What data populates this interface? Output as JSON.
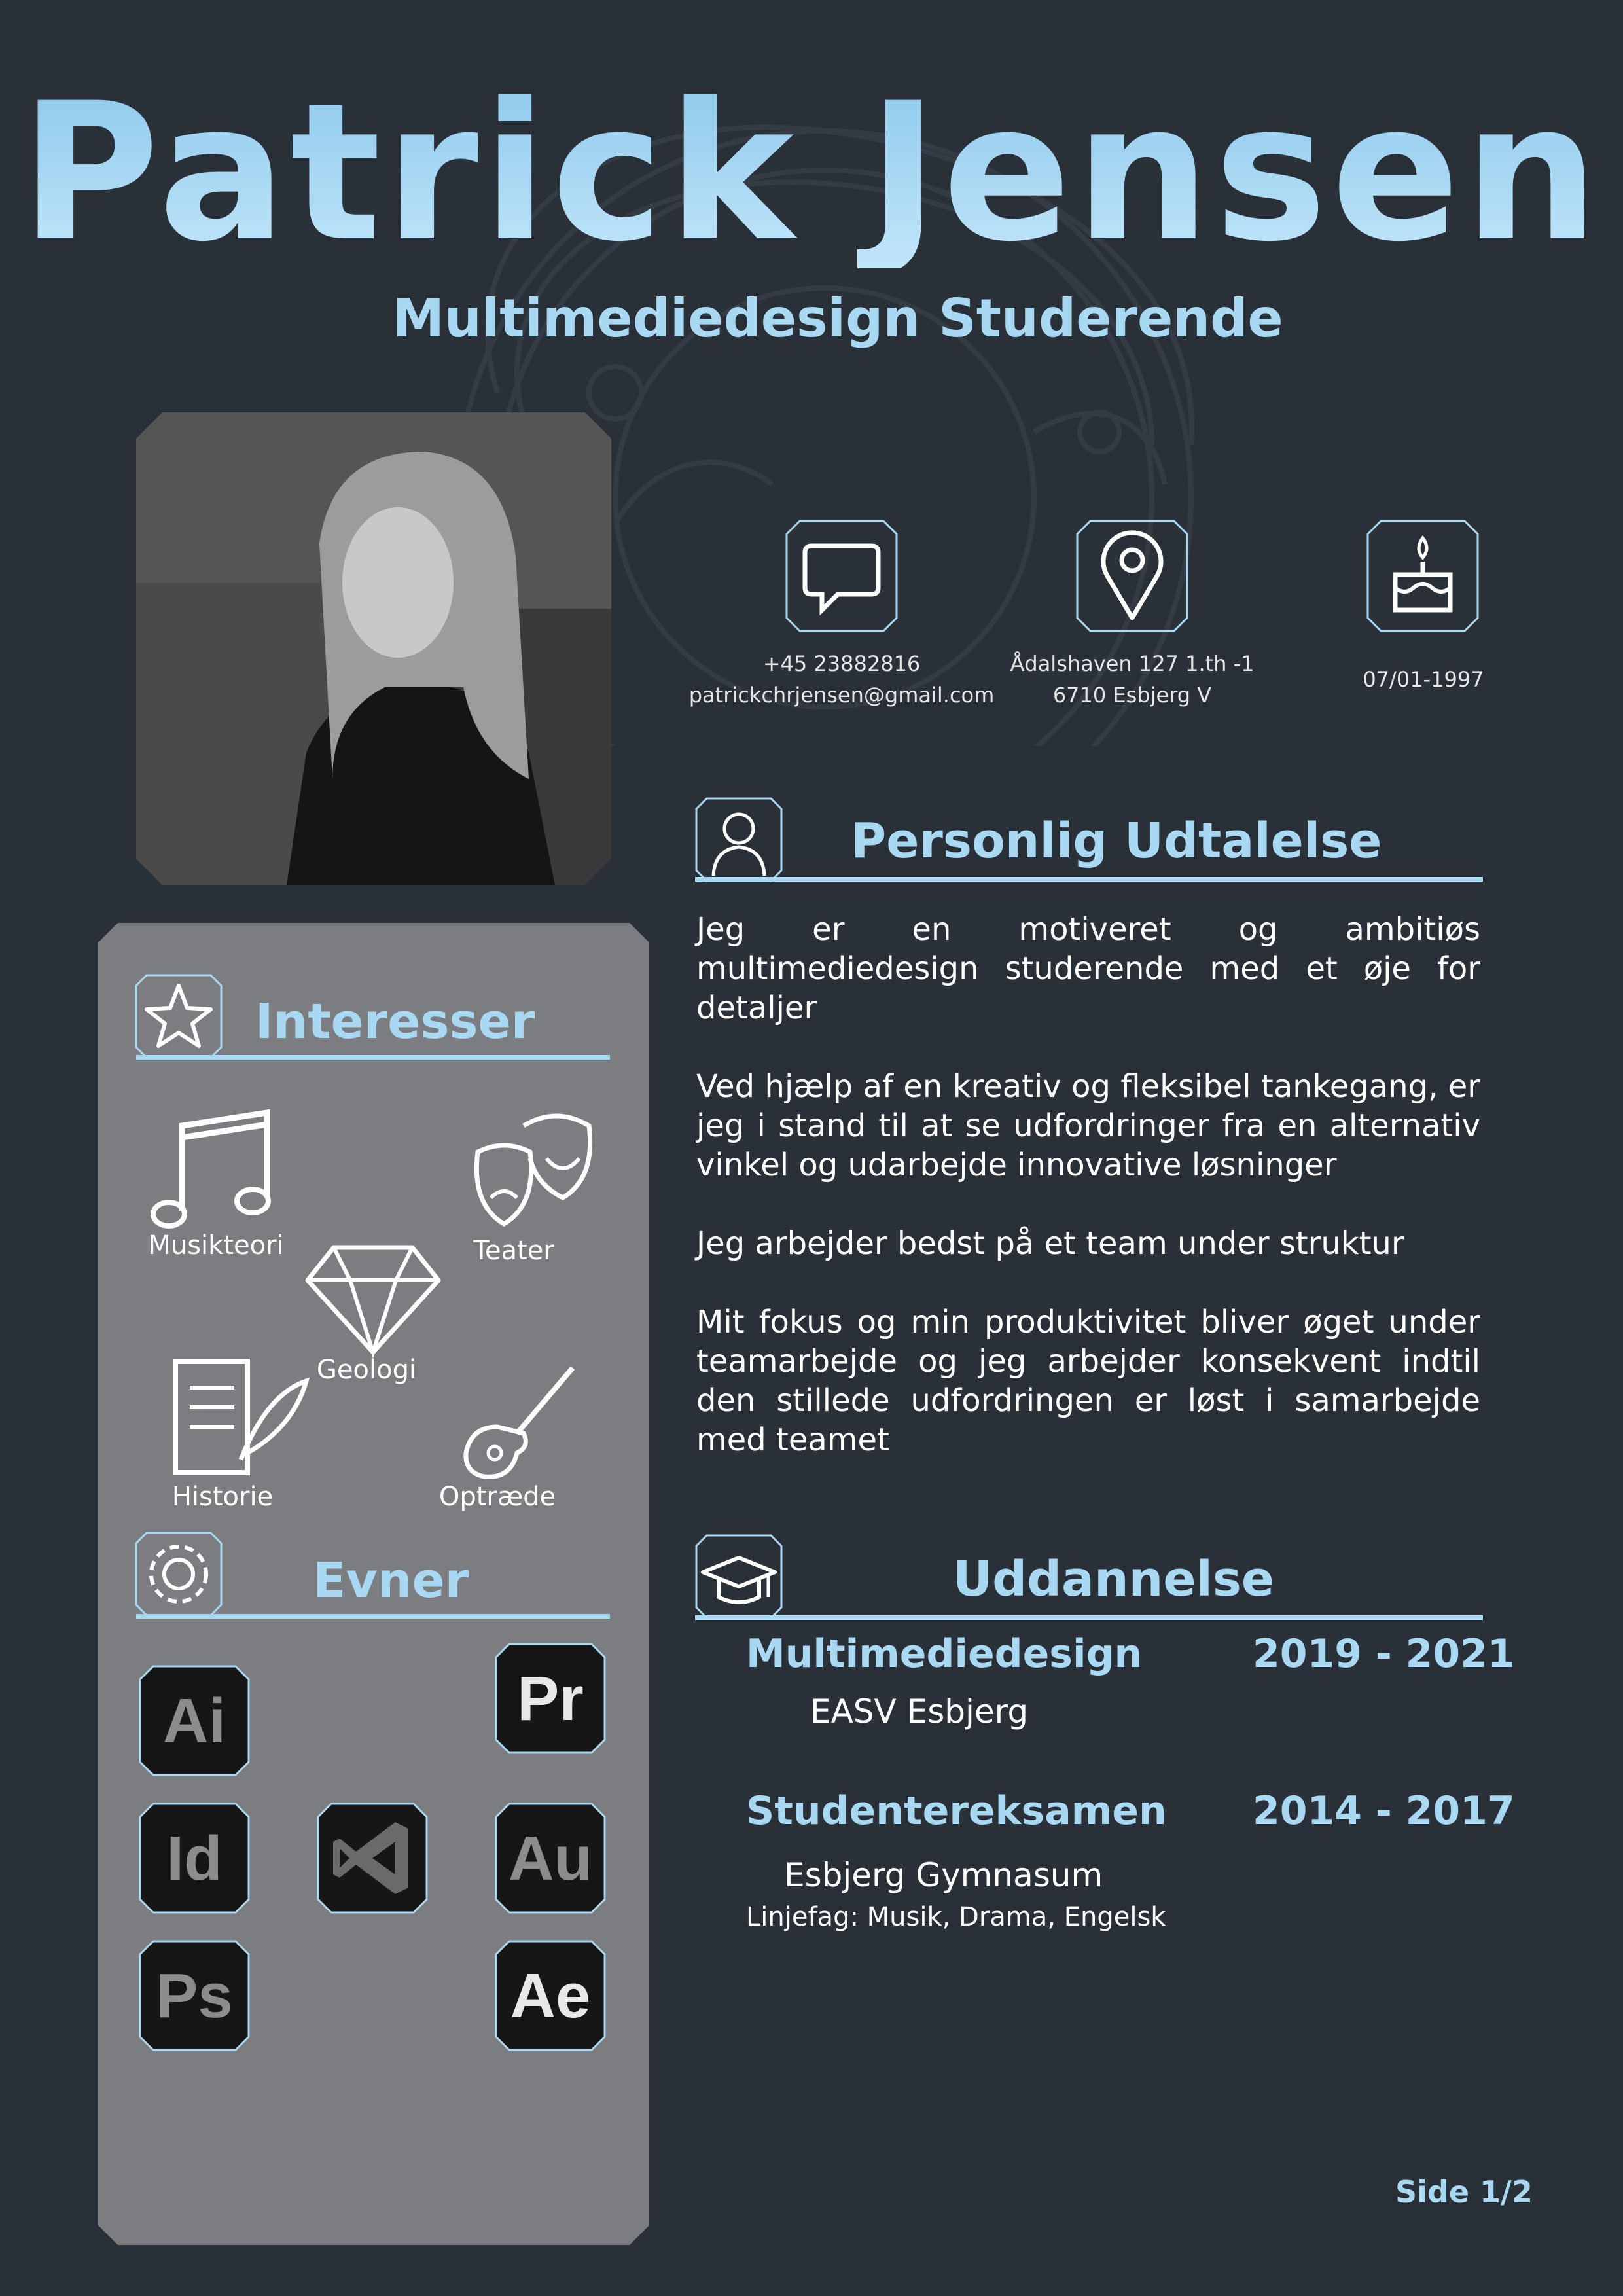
{
  "header": {
    "name": "Patrick Jensen",
    "subtitle": "Multimediedesign Studerende"
  },
  "contact": {
    "phone": "+45 23882816",
    "email": "patrickchrjensen@gmail.com",
    "address_line1": "Ådalshaven 127 1.th -1",
    "address_line2": "6710 Esbjerg V",
    "birthdate": "07/01-1997",
    "icons": [
      "speech-bubble-icon",
      "location-pin-icon",
      "birthday-cake-icon"
    ]
  },
  "statement": {
    "title": "Personlig Udtalelse",
    "paragraphs": [
      "Jeg er en motiveret og ambitiøs multimediedesign studerende med et øje for detaljer",
      "Ved hjælp af en kreativ og fleksibel tankegang, er jeg i stand til at se udfordringer fra en alternativ vinkel og udarbejde innovative løsninger",
      "Jeg arbejder bedst på et team under struktur",
      "Mit fokus og min produktivitet bliver øget under teamarbejde og jeg arbejder konsekvent indtil den stillede udfordringen er løst i samarbejde med teamet"
    ]
  },
  "interests": {
    "title": "Interesser",
    "items": [
      {
        "label": "Musikteori",
        "icon": "music-note-icon"
      },
      {
        "label": "Teater",
        "icon": "theater-masks-icon"
      },
      {
        "label": "Geologi",
        "icon": "diamond-icon"
      },
      {
        "label": "Historie",
        "icon": "scroll-quill-icon"
      },
      {
        "label": "Optræde",
        "icon": "guitar-icon"
      }
    ]
  },
  "skills": {
    "title": "Evner",
    "apps": [
      {
        "abbr": "Ai",
        "name": "illustrator"
      },
      {
        "abbr": "Pr",
        "name": "premiere"
      },
      {
        "abbr": "Id",
        "name": "indesign"
      },
      {
        "abbr": "",
        "name": "visual-studio"
      },
      {
        "abbr": "Au",
        "name": "audition"
      },
      {
        "abbr": "Ps",
        "name": "photoshop"
      },
      {
        "abbr": "Ae",
        "name": "after-effects"
      }
    ]
  },
  "education": {
    "title": "Uddannelse",
    "entries": [
      {
        "degree": "Multimediedesign",
        "years": "2019 - 2021",
        "school": "EASV Esbjerg",
        "note": ""
      },
      {
        "degree": "Studentereksamen",
        "years": "2014 - 2017",
        "school": "Esbjerg Gymnasum",
        "note": "Linjefag: Musik, Drama, Engelsk"
      }
    ]
  },
  "footer": {
    "page": "Side 1/2"
  },
  "colors": {
    "background": "#2a3038",
    "accent": "#a9d8f3",
    "sidebar": "#7b7d80"
  }
}
